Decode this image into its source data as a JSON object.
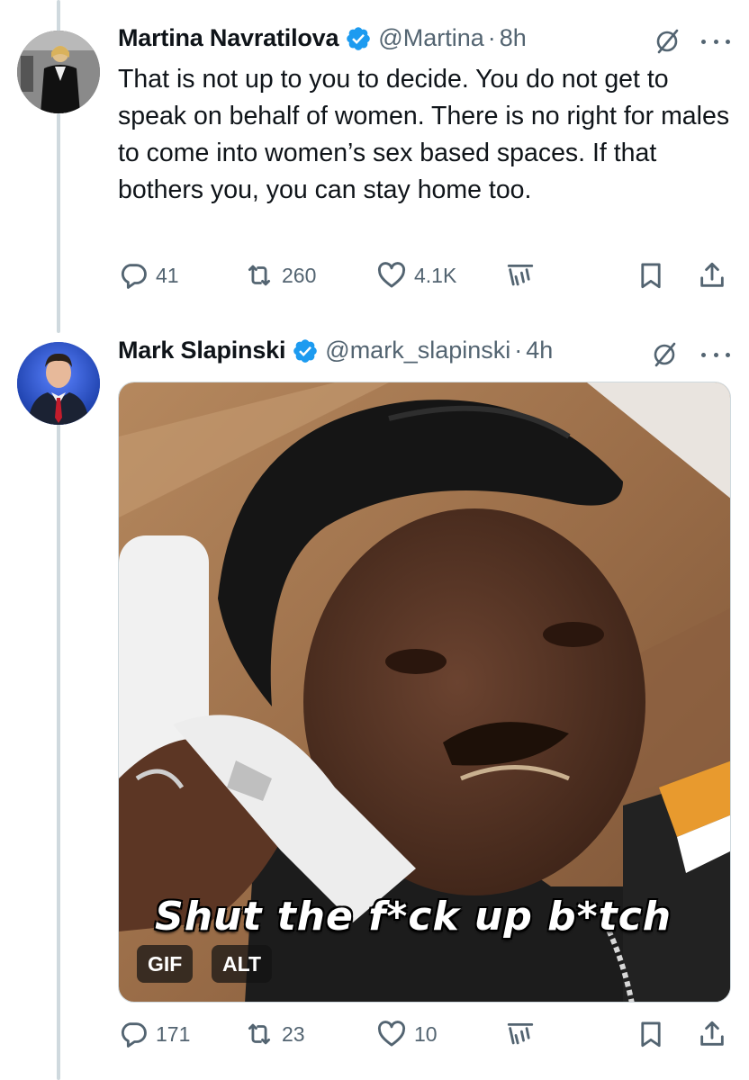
{
  "tweets": [
    {
      "display_name": "Martina Navratilova",
      "handle": "@Martina",
      "time": "8h",
      "text": "That is not up to you to decide. You do not get to speak on behalf of women. There is no right for males to come into women’s sex based spaces. If that bothers you, you can stay home too.",
      "replies": "41",
      "retweets": "260",
      "likes": "4.1K"
    },
    {
      "display_name": "Mark Slapinski",
      "handle": "@mark_slapinski",
      "time": "4h",
      "media": {
        "caption": "Shut the f*ck up b*tch",
        "gif_label": "GIF",
        "alt_label": "ALT"
      },
      "replies": "171",
      "retweets": "23",
      "likes": "10"
    }
  ],
  "header_separator": "·",
  "colors": {
    "verified": "#1d9bf0",
    "secondary_text": "#536471",
    "thread_line": "#cfd9de"
  },
  "icons": [
    "verified-badge-icon",
    "grok-icon",
    "more-icon",
    "reply-icon",
    "retweet-icon",
    "like-icon",
    "views-icon",
    "bookmark-icon",
    "share-icon"
  ]
}
